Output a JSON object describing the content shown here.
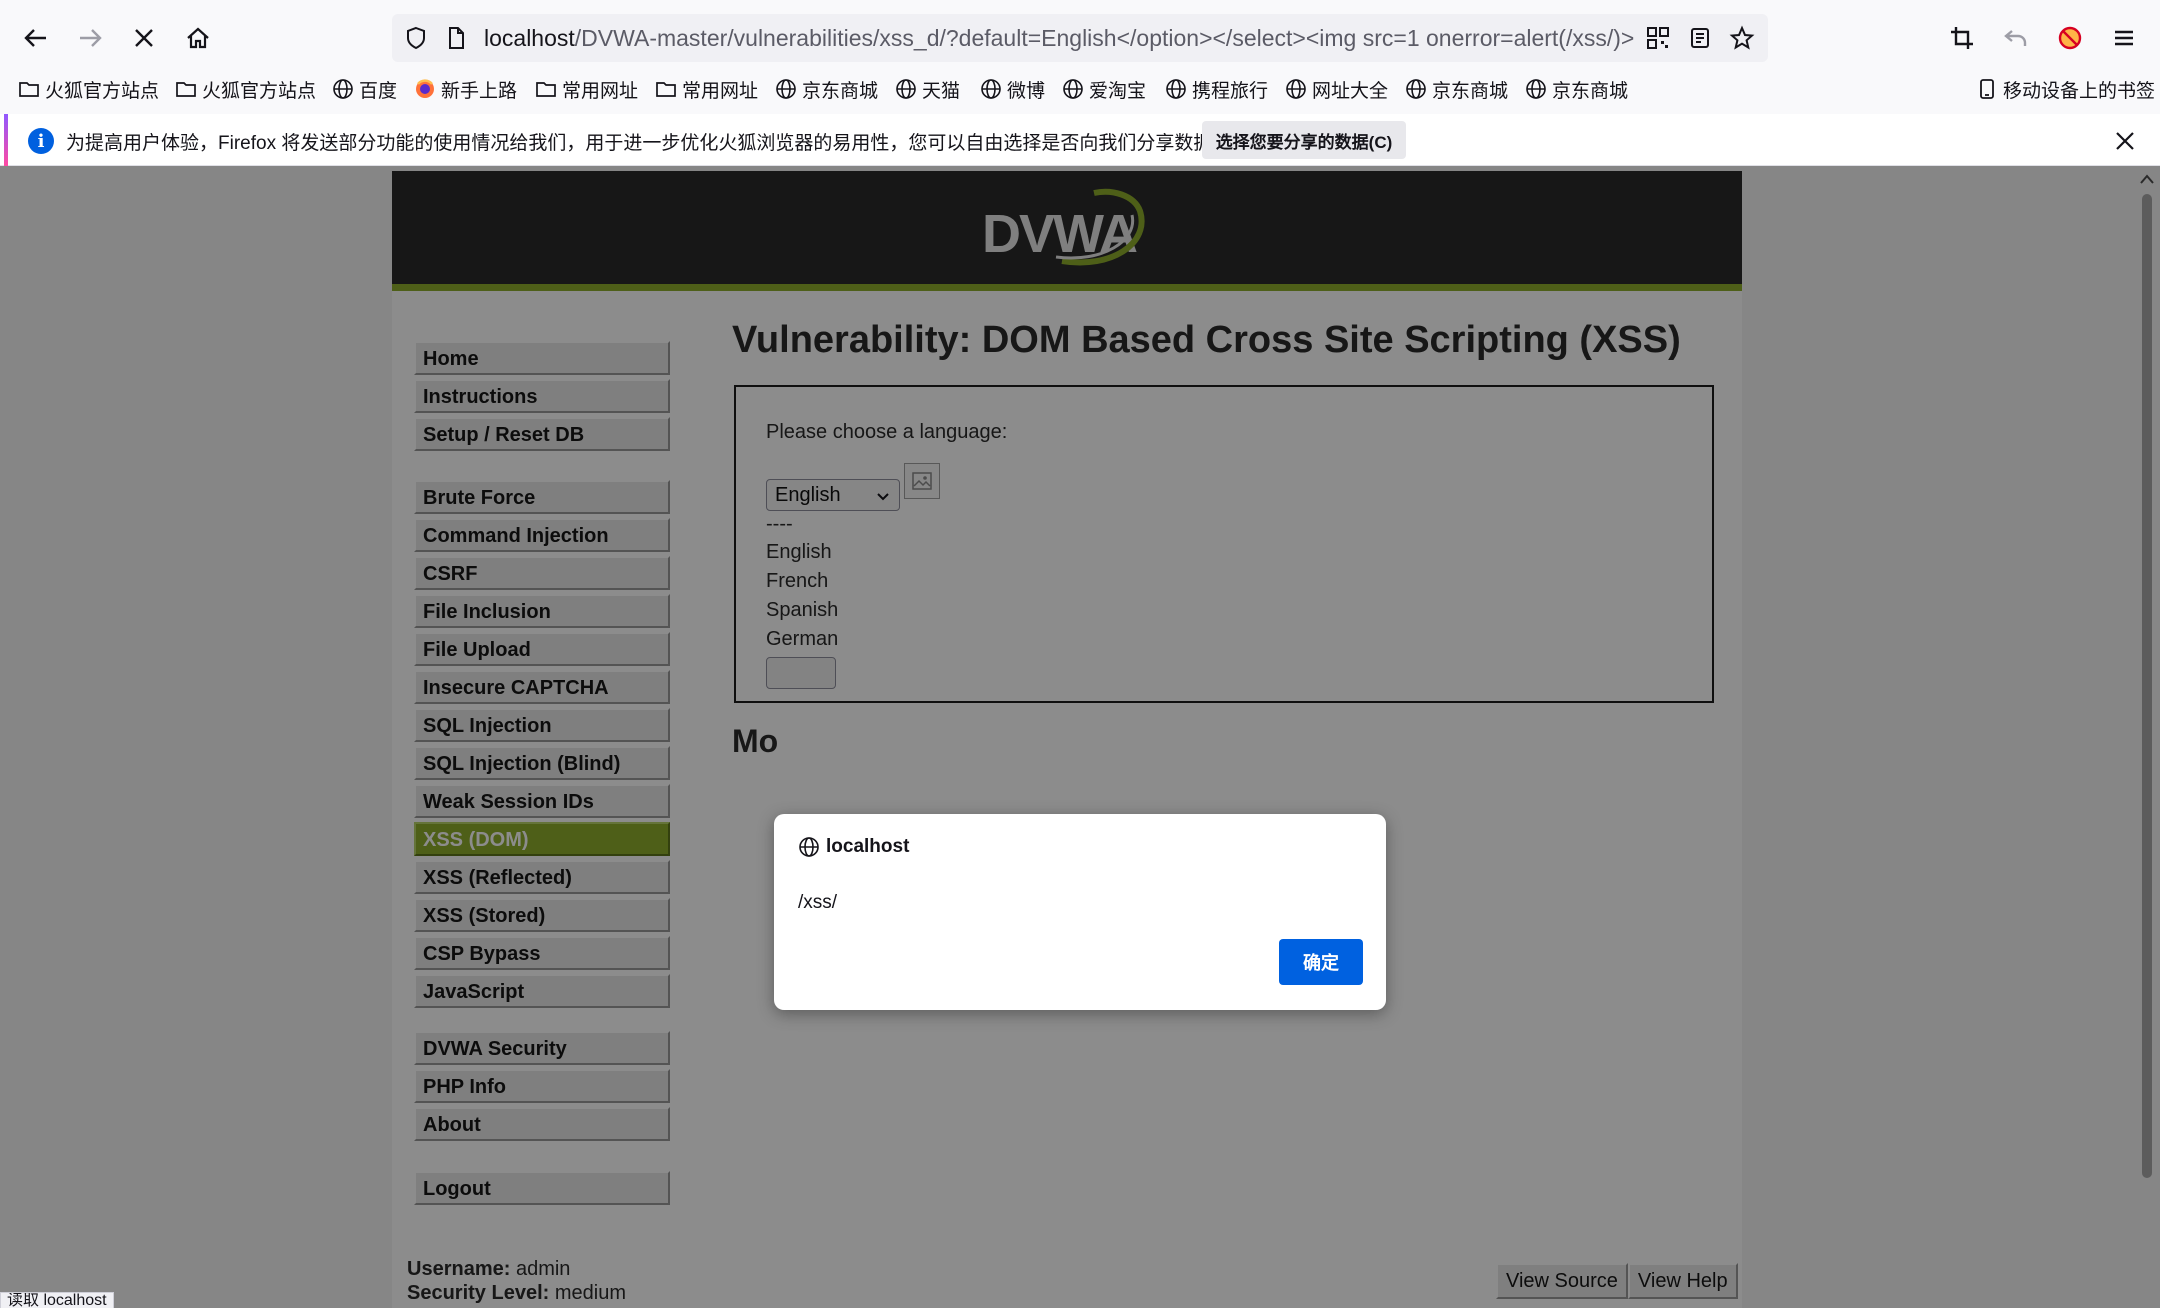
{
  "browser": {
    "url_host": "localhost",
    "url_path": "/DVWA-master/vulnerabilities/xss_d/?default=English</option></select><img src=1 onerror=alert(/xss/)>",
    "bookmarks": [
      {
        "label": "火狐官方站点",
        "icon": "folder-icon"
      },
      {
        "label": "火狐官方站点",
        "icon": "folder-icon"
      },
      {
        "label": "百度",
        "icon": "globe-icon"
      },
      {
        "label": "新手上路",
        "icon": "firefox-icon"
      },
      {
        "label": "常用网址",
        "icon": "folder-icon"
      },
      {
        "label": "常用网址",
        "icon": "folder-icon"
      },
      {
        "label": "京东商城",
        "icon": "globe-icon"
      },
      {
        "label": "天猫",
        "icon": "globe-icon"
      },
      {
        "label": "微博",
        "icon": "globe-icon"
      },
      {
        "label": "爱淘宝",
        "icon": "globe-icon"
      },
      {
        "label": "携程旅行",
        "icon": "globe-icon"
      },
      {
        "label": "网址大全",
        "icon": "globe-icon"
      },
      {
        "label": "京东商城",
        "icon": "globe-icon"
      },
      {
        "label": "京东商城",
        "icon": "globe-icon"
      }
    ],
    "mobile_bookmarks": "移动设备上的书签",
    "notification": {
      "text": "为提高用户体验，Firefox 将发送部分功能的使用情况给我们，用于进一步优化火狐浏览器的易用性，您可以自由选择是否向我们分享数据。",
      "button": "选择您要分享的数据(C)"
    },
    "status_text": "读取 localhost"
  },
  "dvwa": {
    "logo_text": "DVWA",
    "menu_groups": [
      [
        "Home",
        "Instructions",
        "Setup / Reset DB"
      ],
      [
        "Brute Force",
        "Command Injection",
        "CSRF",
        "File Inclusion",
        "File Upload",
        "Insecure CAPTCHA",
        "SQL Injection",
        "SQL Injection (Blind)",
        "Weak Session IDs",
        "XSS (DOM)",
        "XSS (Reflected)",
        "XSS (Stored)",
        "CSP Bypass",
        "JavaScript"
      ],
      [
        "DVWA Security",
        "PHP Info",
        "About"
      ],
      [
        "Logout"
      ]
    ],
    "selected_menu": "XSS (DOM)",
    "title": "Vulnerability: DOM Based Cross Site Scripting (XSS)",
    "choose_label": "Please choose a language:",
    "select_value": "English",
    "option_lines": [
      "----",
      "English",
      "French",
      "Spanish",
      "German"
    ],
    "more_info_heading": "Mo",
    "footer": {
      "username_label": "Username:",
      "username": "admin",
      "security_label": "Security Level:",
      "security": "medium"
    },
    "footer_buttons": [
      "View Source",
      "View Help"
    ]
  },
  "alert": {
    "origin": "localhost",
    "message": "/xss/",
    "ok_label": "确定"
  },
  "colors": {
    "accent_green": "#8eae2c",
    "header_dark": "#2a2a2a",
    "ok_button_blue": "#0061e0"
  }
}
